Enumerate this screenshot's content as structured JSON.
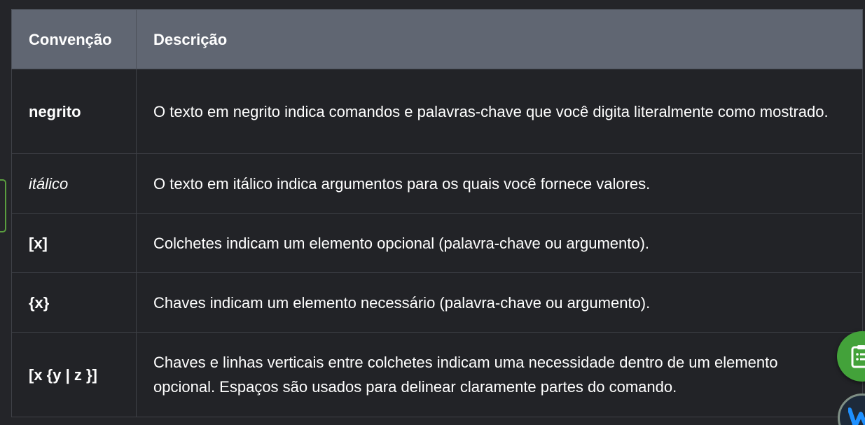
{
  "table": {
    "headers": {
      "convention": "Convenção",
      "description": "Descrição"
    },
    "rows": [
      {
        "convention": "negrito",
        "description": "O texto em negrito indica comandos e palavras-chave que você digita literalmente como mostrado."
      },
      {
        "convention": "itálico",
        "description": "O texto em itálico indica argumentos para os quais você fornece valores."
      },
      {
        "convention": "[x]",
        "description": "Colchetes indicam um elemento opcional (palavra-chave ou argumento)."
      },
      {
        "convention": "{x}",
        "description": "Chaves indicam um elemento necessário (palavra-chave ou argumento)."
      },
      {
        "convention": "[x {y | z }]",
        "description": "Chaves e linhas verticais entre colchetes indicam uma necessidade dentro de um elemento opcional. Espaços são usados para delinear claramente partes do comando."
      }
    ]
  },
  "floating_buttons": {
    "clipboard_icon": "clipboard-list-icon",
    "clipboard_color": "#43a23a",
    "w_icon": "w-logo-icon",
    "w_color": "#1e90ff"
  },
  "side_tab_color": "#5a9e3f"
}
